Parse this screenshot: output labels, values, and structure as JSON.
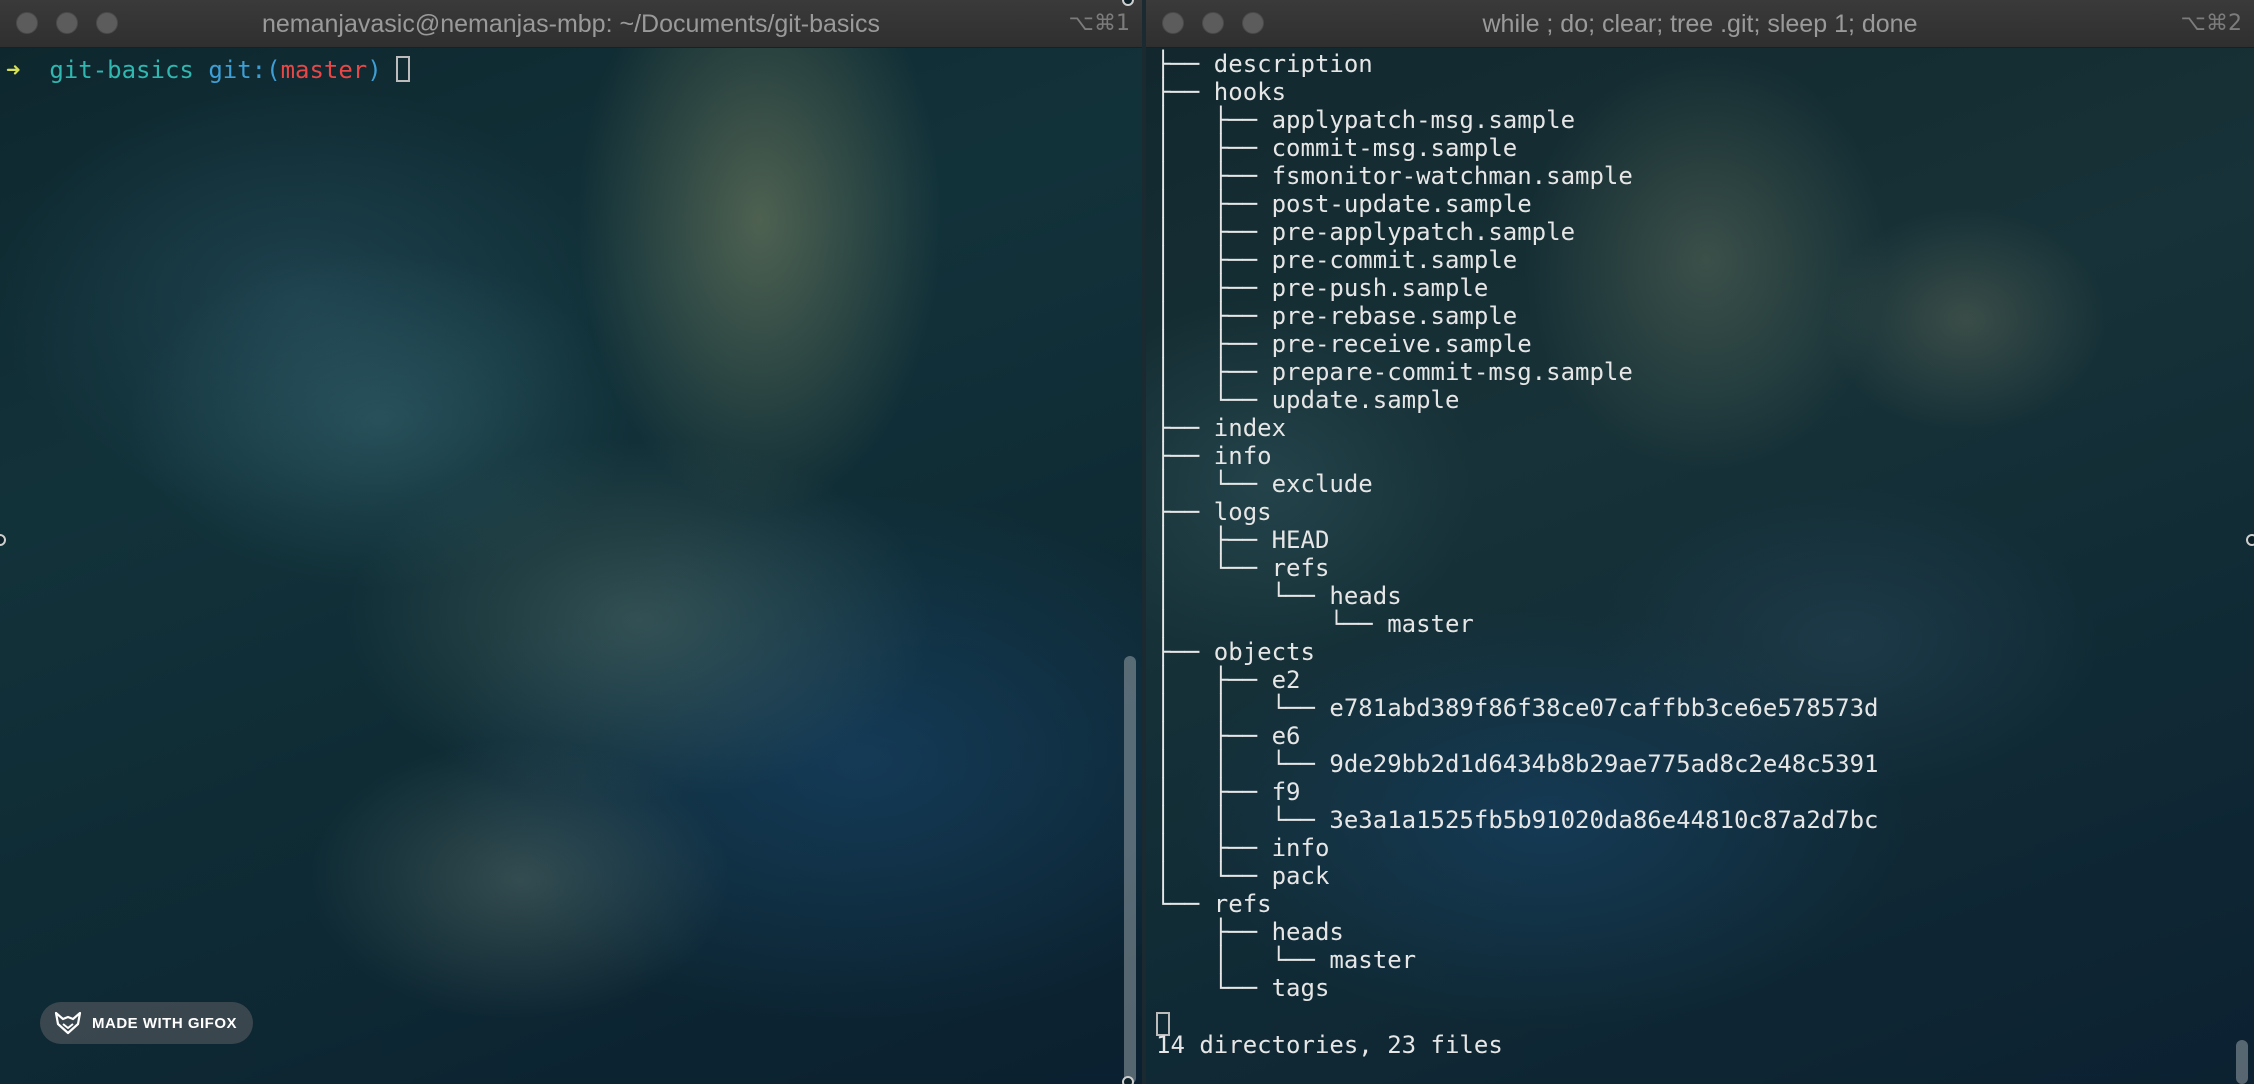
{
  "left_pane": {
    "title": "nemanjavasic@nemanjas-mbp: ~/Documents/git-basics",
    "shortcut": "⌥⌘1",
    "prompt": {
      "arrow": "➜",
      "directory": "git-basics",
      "git_label": "git:(",
      "branch": "master",
      "git_close": ")"
    }
  },
  "right_pane": {
    "title": "while ; do; clear; tree .git; sleep 1; done",
    "shortcut": "⌥⌘2",
    "tree_lines": [
      "├── description",
      "├── hooks",
      "│   ├── applypatch-msg.sample",
      "│   ├── commit-msg.sample",
      "│   ├── fsmonitor-watchman.sample",
      "│   ├── post-update.sample",
      "│   ├── pre-applypatch.sample",
      "│   ├── pre-commit.sample",
      "│   ├── pre-push.sample",
      "│   ├── pre-rebase.sample",
      "│   ├── pre-receive.sample",
      "│   ├── prepare-commit-msg.sample",
      "│   └── update.sample",
      "├── index",
      "├── info",
      "│   └── exclude",
      "├── logs",
      "│   ├── HEAD",
      "│   └── refs",
      "│       └── heads",
      "│           └── master",
      "├── objects",
      "│   ├── e2",
      "│   │   └── e781abd389f86f38ce07caffbb3ce6e578573d",
      "│   ├── e6",
      "│   │   └── 9de29bb2d1d6434b8b29ae775ad8c2e48c5391",
      "│   ├── f9",
      "│   │   └── 3e3a1a1525fb5b91020da86e44810c87a2d7bc",
      "│   ├── info",
      "│   └── pack",
      "└── refs",
      "    ├── heads",
      "    │   └── master",
      "    └── tags"
    ],
    "summary": "14 directories, 23 files"
  },
  "watermark": {
    "label": "MADE WITH GIFOX",
    "icon": "fox-icon"
  },
  "colors": {
    "prompt_arrow": "#d5e05a",
    "directory": "#2fb7b0",
    "git_label": "#3d9fd6",
    "branch": "#e84747",
    "titlebar": "#333333"
  }
}
